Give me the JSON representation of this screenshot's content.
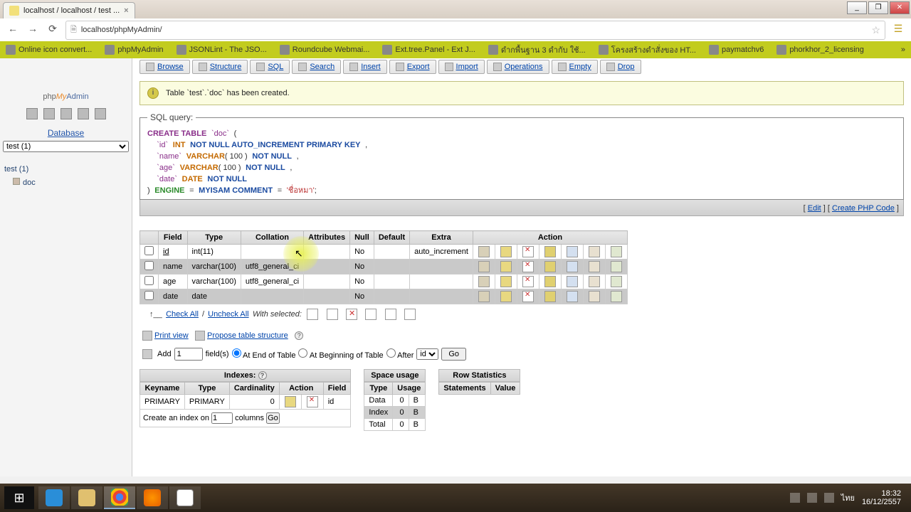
{
  "browser": {
    "tab_title": "localhost / localhost / test ...",
    "url": "localhost/phpMyAdmin/",
    "window_min": "_",
    "window_max": "❐",
    "window_close": "✕"
  },
  "bookmarks": [
    "Online icon convert...",
    "phpMyAdmin",
    "JSONLint - The JSO...",
    "Roundcube Webmai...",
    "Ext.tree.Panel - Ext J...",
    "ดำกพื้นฐาน 3 ดำกับ ใช้...",
    "โครงสร้างดำสั่งของ HT...",
    "paymatchv6",
    "phorkhor_2_licensing"
  ],
  "logo": {
    "php": "php",
    "my": "My",
    "admin": "Admin"
  },
  "sidebar": {
    "db_label": "Database",
    "db_selected": "test (1)",
    "db_name": "test (1)",
    "table": "doc"
  },
  "tabs": {
    "browse": "Browse",
    "structure": "Structure",
    "sql": "SQL",
    "search": "Search",
    "insert": "Insert",
    "export": "Export",
    "import": "Import",
    "operations": "Operations",
    "empty": "Empty",
    "drop": "Drop"
  },
  "message": "Table `test`.`doc` has been created.",
  "sql_legend": "SQL query:",
  "sql": {
    "l1a": "CREATE TABLE",
    "l1b": "`doc`",
    "l1c": "(",
    "l2a": "`id`",
    "l2b": "INT",
    "l2c": "NOT NULL AUTO_INCREMENT PRIMARY KEY",
    "l2d": ",",
    "l3a": "`name`",
    "l3b": "VARCHAR",
    "l3c": "( 100 )",
    "l3d": "NOT NULL",
    "l3e": ",",
    "l4a": "`age`",
    "l4b": "VARCHAR",
    "l4c": "( 100 )",
    "l4d": "NOT NULL",
    "l4e": ",",
    "l5a": "`date`",
    "l5b": "DATE",
    "l5c": "NOT NULL",
    "l6a": ")",
    "l6b": "ENGINE",
    "l6c": "=",
    "l6d": "MYISAM COMMENT",
    "l6e": "=",
    "l6f": "'ชื่อหมา'",
    "l6g": ";"
  },
  "sql_footer": {
    "open1": "[ ",
    "edit": "Edit",
    "mid": " ] [ ",
    "create": "Create PHP Code",
    "close": " ]"
  },
  "cols": {
    "field": "Field",
    "type": "Type",
    "collation": "Collation",
    "attributes": "Attributes",
    "null": "Null",
    "default": "Default",
    "extra": "Extra",
    "action": "Action"
  },
  "rows": [
    {
      "field": "id",
      "type": "int(11)",
      "collation": "",
      "attributes": "",
      "null": "No",
      "default": "",
      "extra": "auto_increment"
    },
    {
      "field": "name",
      "type": "varchar(100)",
      "collation": "utf8_general_ci",
      "attributes": "",
      "null": "No",
      "default": "",
      "extra": ""
    },
    {
      "field": "age",
      "type": "varchar(100)",
      "collation": "utf8_general_ci",
      "attributes": "",
      "null": "No",
      "default": "",
      "extra": ""
    },
    {
      "field": "date",
      "type": "date",
      "collation": "",
      "attributes": "",
      "null": "No",
      "default": "",
      "extra": ""
    }
  ],
  "check": {
    "all": "Check All",
    "sep": " / ",
    "un": "Uncheck All",
    "ws": "With selected:"
  },
  "sub": {
    "print": "Print view",
    "propose": "Propose table structure"
  },
  "add": {
    "label": "Add",
    "count": "1",
    "fields": "field(s)",
    "end": "At End of Table",
    "begin": "At Beginning of Table",
    "after": "After",
    "after_val": "id",
    "go": "Go"
  },
  "indexes": {
    "title": "Indexes:",
    "keyname": "Keyname",
    "type": "Type",
    "card": "Cardinality",
    "action": "Action",
    "field": "Field",
    "r_key": "PRIMARY",
    "r_type": "PRIMARY",
    "r_card": "0",
    "r_field": "id",
    "create": "Create an index on",
    "cols": "1",
    "columns": "columns",
    "go": "Go"
  },
  "space": {
    "title": "Space usage",
    "type": "Type",
    "usage": "Usage",
    "data": "Data",
    "d0": "0",
    "dB": "B",
    "index": "Index",
    "i0": "0",
    "iB": "B",
    "total": "Total",
    "t0": "0",
    "tB": "B"
  },
  "rowstat": {
    "title": "Row Statistics",
    "stmt": "Statements",
    "val": "Value"
  },
  "task": {
    "time": "18:32",
    "date": "16/12/2557",
    "lang": "ไทย"
  }
}
